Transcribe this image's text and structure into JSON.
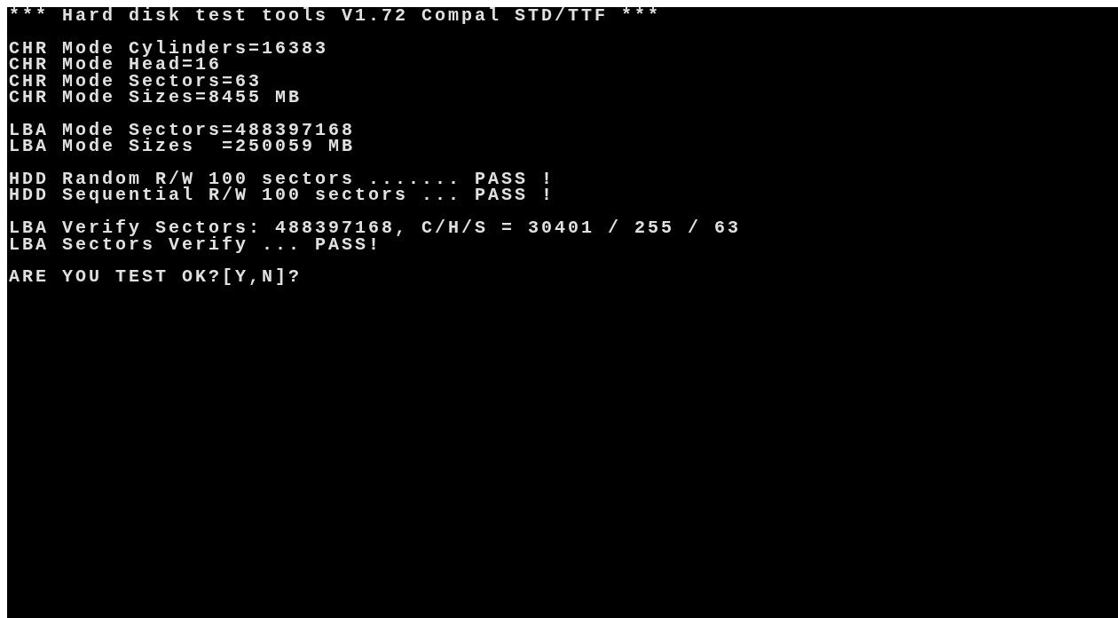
{
  "screen": {
    "blocks": [
      [
        "*** Hard disk test tools V1.72 Compal STD/TTF ***"
      ],
      [
        "CHR Mode Cylinders=16383",
        "CHR Mode Head=16",
        "CHR Mode Sectors=63",
        "CHR Mode Sizes=8455 MB"
      ],
      [
        "LBA Mode Sectors=488397168",
        "LBA Mode Sizes  =250059 MB"
      ],
      [
        "HDD Random R/W 100 sectors ....... PASS !",
        "HDD Sequential R/W 100 sectors ... PASS !"
      ],
      [
        "LBA Verify Sectors: 488397168, C/H/S = 30401 / 255 / 63",
        "LBA Sectors Verify ... PASS!"
      ],
      [
        "ARE YOU TEST OK?[Y,N]?"
      ]
    ]
  }
}
